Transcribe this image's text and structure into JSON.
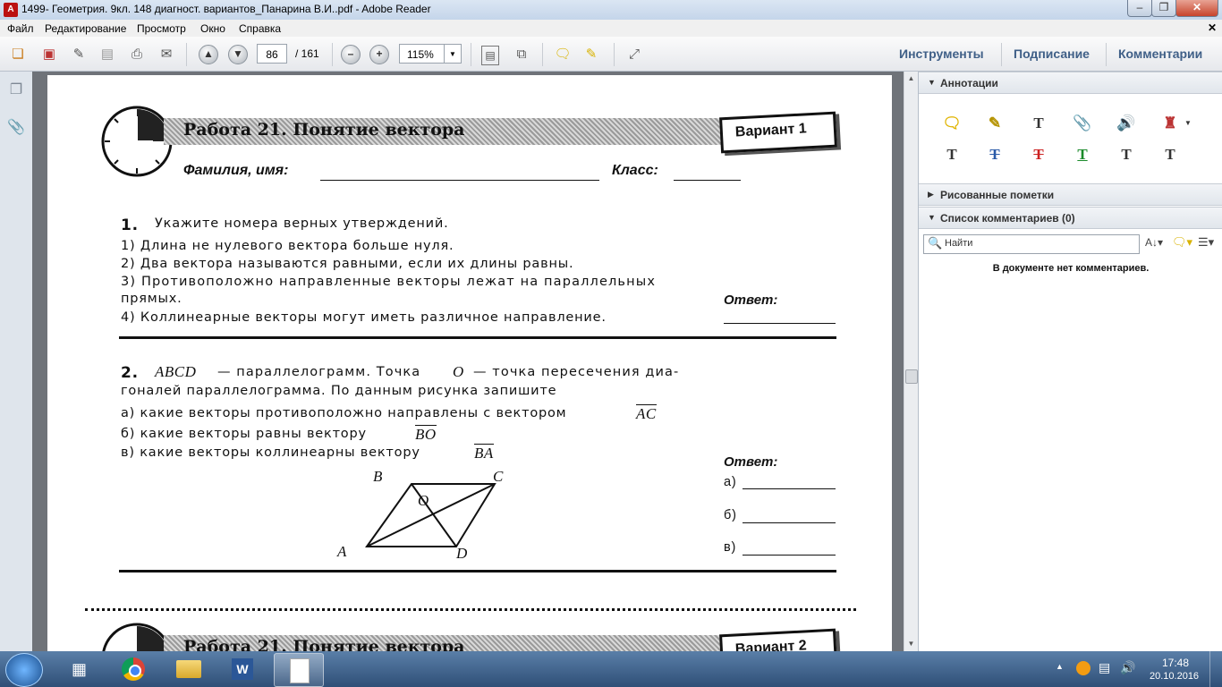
{
  "window": {
    "title": "1499- Геометрия. 9кл. 148 диагност. вариантов_Панарина В.И..pdf - Adobe Reader",
    "app_icon": "pdf-icon"
  },
  "menu": [
    "Файл",
    "Редактирование",
    "Просмотр",
    "Окно",
    "Справка"
  ],
  "toolbar": {
    "page_current": "86",
    "page_total": "/ 161",
    "zoom": "115%",
    "right_links": [
      "Инструменты",
      "Подписание",
      "Комментарии"
    ]
  },
  "right_panel": {
    "annotations_header": "Аннотации",
    "drawing_header": "Рисованные пометки",
    "comments_header": "Список комментариев (0)",
    "search_placeholder": "Найти",
    "no_comments": "В документе нет комментариев."
  },
  "document": {
    "work_title": "Работа 21. Понятие вектора",
    "variant": "Вариант 1",
    "variant_next": "Вариант 2",
    "name_label": "Фамилия, имя:",
    "class_label": "Класс:",
    "task1": {
      "number": "1.",
      "prompt": "Укажите номера верных утверждений.",
      "items": [
        "1) Длина не нулевого вектора больше нуля.",
        "2) Два вектора называются равными, если их длины равны.",
        "3) Противоположно направленные векторы лежат на параллельных",
        "прямых.",
        "4) Коллинеарные векторы могут иметь различное направление."
      ],
      "answer_label": "Ответ:"
    },
    "task2": {
      "number": "2.",
      "abcd": "ABCD",
      "line1_rest": "— параллелограмм. Точка",
      "o_letter": "O",
      "line1_end": "— точка пересечения диа-",
      "line2": "гоналей параллелограмма. По данным рисунка запишите",
      "a_text": "а) какие векторы противоположно направлены с вектором",
      "a_vec": "AC",
      "b_text": "б) какие векторы равны вектору",
      "b_vec": "BO",
      "c_text": "в) какие векторы коллинеарны вектору",
      "c_vec": "BA",
      "answer_label": "Ответ:",
      "answer_a": "а)",
      "answer_b": "б)",
      "answer_c": "в)",
      "points": {
        "A": "A",
        "B": "B",
        "C": "C",
        "D": "D",
        "O": "O"
      }
    }
  },
  "taskbar": {
    "time": "17:48",
    "date": "20.10.2016"
  }
}
